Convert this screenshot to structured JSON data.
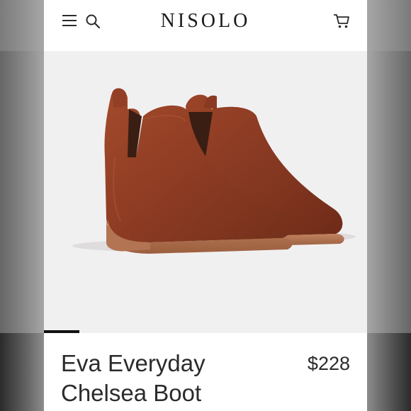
{
  "header": {
    "brand": "NISOLO",
    "icons": [
      "menu-icon",
      "search-icon",
      "cart-icon"
    ]
  },
  "gallery": {
    "image_alt": "Eva Everyday Chelsea Boot",
    "progress": 0.11
  },
  "product": {
    "name_line1": "Eva Everyday",
    "name_line2": "Chelsea Boot",
    "price": "$228"
  },
  "colors": {
    "leather": "#8a3a22",
    "sole": "#b57652",
    "background": "#f1f0f1"
  }
}
